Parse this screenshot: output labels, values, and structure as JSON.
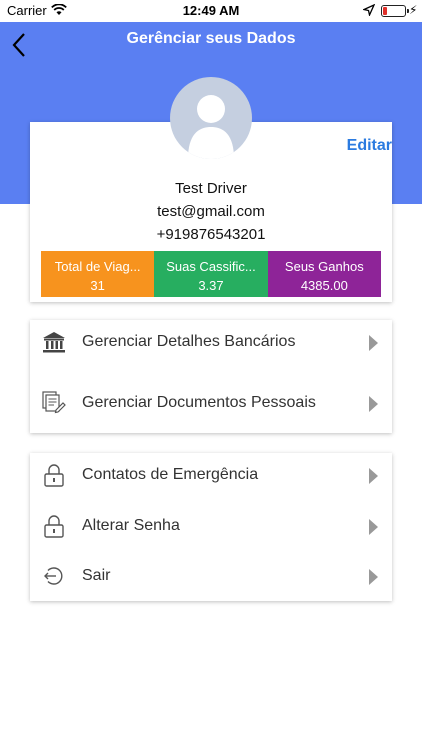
{
  "status_bar": {
    "carrier": "Carrier",
    "time": "12:49 AM"
  },
  "header": {
    "title": "Gerênciar seus Dados"
  },
  "profile": {
    "edit_label": "Editar",
    "name": "Test Driver",
    "email": "test@gmail.com",
    "phone": "+919876543201"
  },
  "stats": [
    {
      "label": "Total de Viag...",
      "value": "31",
      "color": "#f7931e"
    },
    {
      "label": "Suas Cassific...",
      "value": "3.37",
      "color": "#27ae60"
    },
    {
      "label": "Seus Ganhos",
      "value": "4385.00",
      "color": "#8e2498"
    }
  ],
  "menu_groups": [
    [
      {
        "label": "Gerenciar Detalhes Bancários",
        "icon": "bank-icon"
      },
      {
        "label": "Gerenciar Documentos Pessoais",
        "icon": "documents-icon"
      }
    ],
    [
      {
        "label": "Contatos de Emergência",
        "icon": "lock-icon"
      },
      {
        "label": "Alterar Senha",
        "icon": "lock-icon"
      },
      {
        "label": "Sair",
        "icon": "logout-icon"
      }
    ]
  ],
  "colors": {
    "header": "#5a7ff2",
    "accent": "#2b7be0"
  }
}
